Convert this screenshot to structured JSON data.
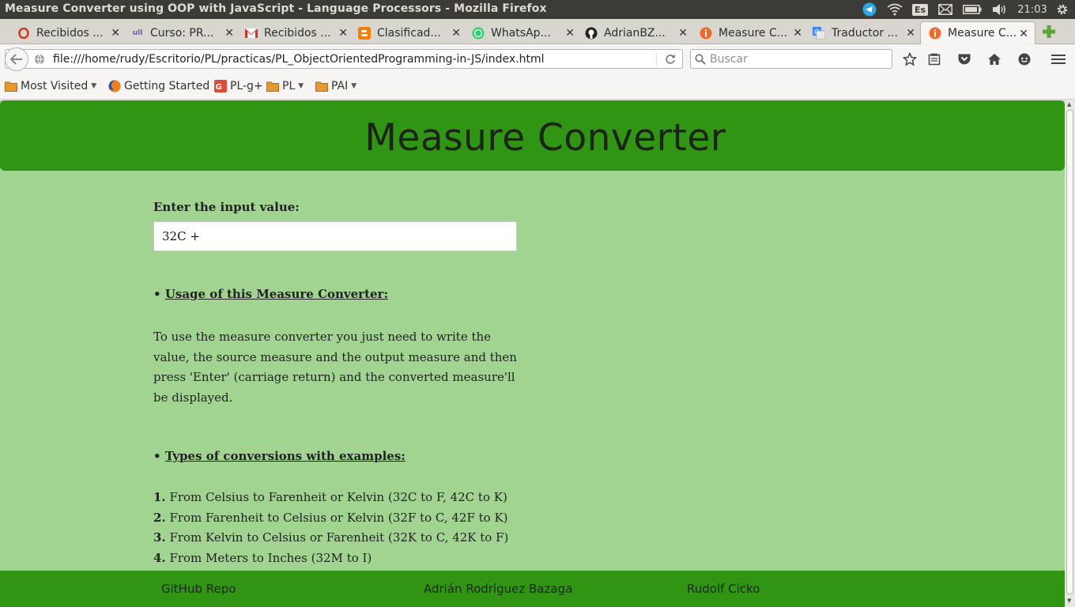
{
  "window": {
    "title": "Measure Converter using OOP with JavaScript - Language Processors - Mozilla Firefox",
    "keyboard_layout": "Es",
    "clock": "21:03"
  },
  "tabs": [
    {
      "label": "Recibidos ...",
      "icon": "opera-icon"
    },
    {
      "label": "Curso: PR...",
      "icon": "ull-icon"
    },
    {
      "label": "Recibidos ...",
      "icon": "gmail-icon"
    },
    {
      "label": "Clasificad...",
      "icon": "blogger-icon"
    },
    {
      "label": "WhatsAp...",
      "icon": "whatsapp-icon"
    },
    {
      "label": "AdrianBZ...",
      "icon": "github-icon"
    },
    {
      "label": "Measure C...",
      "icon": "info-icon"
    },
    {
      "label": "Traductor ...",
      "icon": "google-translate-icon"
    },
    {
      "label": "Measure C...",
      "icon": "info-icon",
      "active": true
    }
  ],
  "navbar": {
    "url": "file:///home/rudy/Escritorio/PL/practicas/PL_ObjectOrientedProgramming-in-JS/index.html",
    "search_placeholder": "Buscar"
  },
  "bookmarks": [
    {
      "label": "Most Visited",
      "dropdown": true
    },
    {
      "label": "Getting Started",
      "dropdown": false
    },
    {
      "label": "PL-g+",
      "dropdown": false
    },
    {
      "label": "PL",
      "dropdown": true
    },
    {
      "label": "PAI",
      "dropdown": true
    }
  ],
  "page": {
    "heading": "Measure Converter",
    "input_label": "Enter the input value:",
    "input_value": "32C +",
    "usage_title": "Usage of this Measure Converter:",
    "usage_text": "To use the measure converter you just need to write the value, the source measure and the output measure and then press 'Enter' (carriage return) and the converted measure'll be displayed.",
    "types_title": "Types of conversions with examples:",
    "conversions": [
      {
        "num": "1.",
        "text": "From Celsius to Farenheit or Kelvin (32C to F, 42C to K)"
      },
      {
        "num": "2.",
        "text": "From Farenheit to Celsius or Kelvin (32F to C, 42F to K)"
      },
      {
        "num": "3.",
        "text": "From Kelvin to Celsius or Farenheit (32K to C, 42K to F)"
      },
      {
        "num": "4.",
        "text": "From Meters to Inches (32M to I)"
      }
    ],
    "footer": {
      "repo": "GitHub Repo",
      "author1": "Adrián Rodríguez Bazaga",
      "author2": "Rudolf Cicko"
    }
  },
  "colors": {
    "header_green": "#2f9512",
    "page_bg": "#a1d490"
  }
}
